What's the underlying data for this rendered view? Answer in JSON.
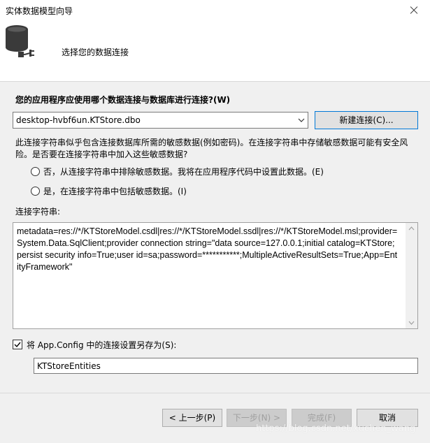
{
  "window": {
    "title": "实体数据模型向导"
  },
  "header": {
    "heading": "选择您的数据连接"
  },
  "connection": {
    "question": "您的应用程序应使用哪个数据连接与数据库进行连接?(W)",
    "selected": "desktop-hvbf6un.KTStore.dbo",
    "new_connection_label": "新建连接(C)..."
  },
  "sensitive": {
    "warning": "此连接字符串似乎包含连接数据库所需的敏感数据(例如密码)。在连接字符串中存储敏感数据可能有安全风险。是否要在连接字符串中加入这些敏感数据?",
    "option_no": "否，从连接字符串中排除敏感数据。我将在应用程序代码中设置此数据。(E)",
    "option_yes": "是，在连接字符串中包括敏感数据。(I)"
  },
  "connection_string": {
    "label": "连接字符串:",
    "value": "metadata=res://*/KTStoreModel.csdl|res://*/KTStoreModel.ssdl|res://*/KTStoreModel.msl;provider=System.Data.SqlClient;provider connection string=\"data source=127.0.0.1;initial catalog=KTStore;persist security info=True;user id=sa;password=***********;MultipleActiveResultSets=True;App=EntityFramework\""
  },
  "save": {
    "checked": true,
    "label": "将 App.Config 中的连接设置另存为(S):",
    "name": "KTStoreEntities"
  },
  "buttons": {
    "back": "< 上一步(P)",
    "next": "下一步(N) >",
    "finish": "完成(F)",
    "cancel": "取消"
  },
  "watermark": "https://blog.csdn.net/xuchen_wang"
}
